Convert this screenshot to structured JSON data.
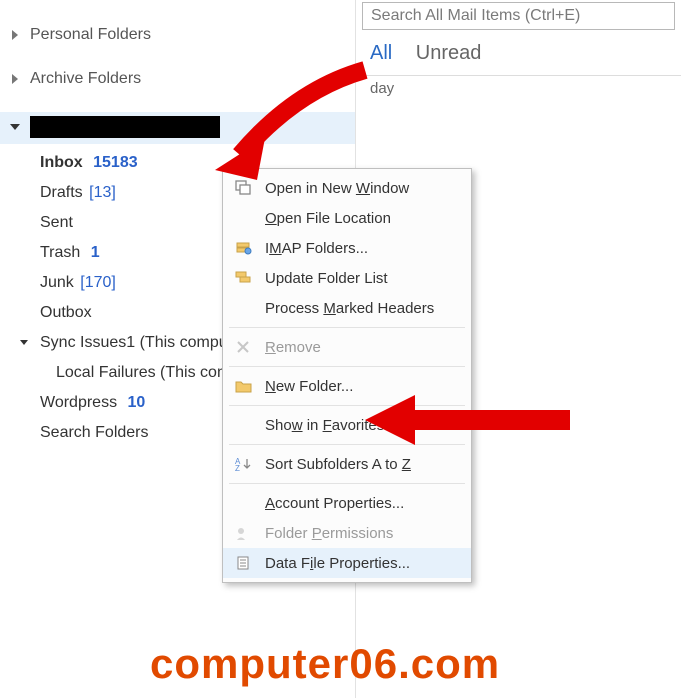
{
  "sidebar": {
    "personal": "Personal Folders",
    "archive": "Archive Folders",
    "folders": {
      "inbox": {
        "name": "Inbox",
        "count": "15183"
      },
      "drafts": {
        "name": "Drafts",
        "count": "[13]"
      },
      "sent": {
        "name": "Sent"
      },
      "trash": {
        "name": "Trash",
        "count": "1"
      },
      "junk": {
        "name": "Junk",
        "count": "[170]"
      },
      "outbox": {
        "name": "Outbox"
      },
      "sync": {
        "name": "Sync Issues1 (This compu"
      },
      "localf": {
        "name": "Local Failures (This com"
      },
      "wp": {
        "name": "Wordpress",
        "count": "10"
      },
      "search": {
        "name": "Search Folders"
      }
    }
  },
  "main": {
    "search_placeholder": "Search All Mail Items (Ctrl+E)",
    "filter_all": "All",
    "filter_unread": "Unread",
    "today": "day"
  },
  "ctx": {
    "open_window_pre": "Open in New ",
    "open_window_m": "W",
    "open_window_post": "indow",
    "open_loc_m": "O",
    "open_loc_post": "pen File Location",
    "imap_pre": "I",
    "imap_m": "M",
    "imap_post": "AP Folders...",
    "update": "Update Folder List",
    "process_pre": "Process ",
    "process_m": "M",
    "process_post": "arked Headers",
    "remove_m": "R",
    "remove_post": "emove",
    "newf_m": "N",
    "newf_post": "ew Folder...",
    "fav_pre": "Sho",
    "fav_m": "w",
    "fav_mid": " in ",
    "fav_m2": "F",
    "fav_post": "avorites",
    "sort_pre": "Sort Subfolders A to ",
    "sort_m": "Z",
    "acct_m": "A",
    "acct_post": "ccount Properties...",
    "perm": "Folder ",
    "perm_m": "P",
    "perm_post": "ermissions",
    "data_pre": "Data F",
    "data_m": "i",
    "data_post": "le Properties..."
  },
  "watermark": "computer06.com"
}
